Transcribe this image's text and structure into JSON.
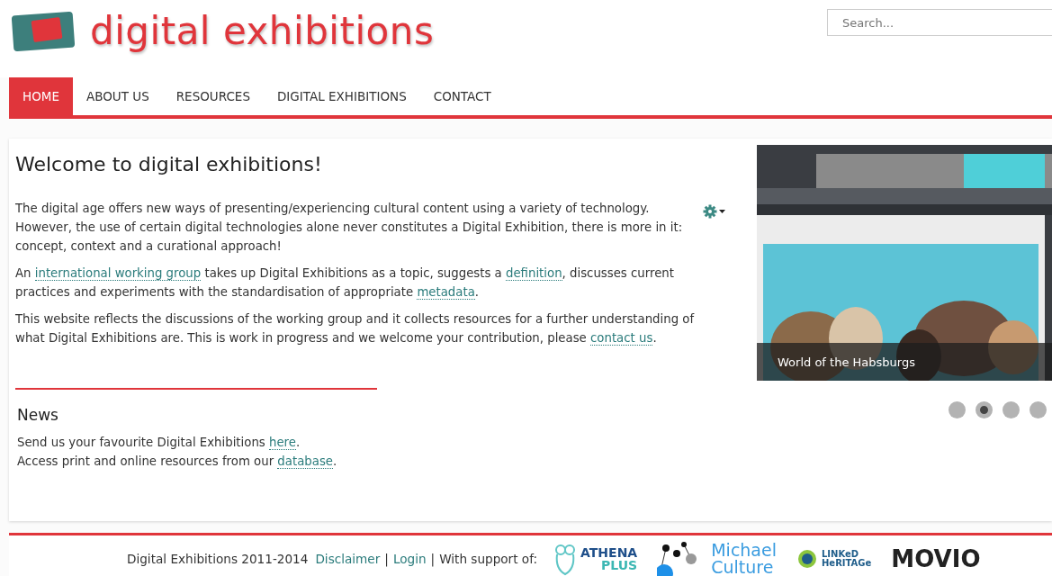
{
  "logo": {
    "text": "digital exhibitions"
  },
  "search": {
    "placeholder": "Search..."
  },
  "nav": [
    {
      "label": "HOME",
      "selected": true
    },
    {
      "label": "ABOUT US",
      "selected": false
    },
    {
      "label": "RESOURCES",
      "selected": false
    },
    {
      "label": "DIGITAL EXHIBITIONS",
      "selected": false
    },
    {
      "label": "CONTACT",
      "selected": false
    }
  ],
  "article": {
    "title": "Welcome to digital exhibitions!",
    "paragraphs": [
      [
        {
          "kind": "text",
          "text": "The digital age offers new ways of presenting/experiencing cultural content using a variety of technology. However, the use of certain digital technologies alone never constitutes a Digital Exhibition, there is more in it: concept, context and a curational approach!"
        }
      ],
      [
        {
          "kind": "text",
          "text": "An "
        },
        {
          "kind": "link",
          "text": "international working group"
        },
        {
          "kind": "text",
          "text": " takes up Digital Exhibitions as a topic, suggests a "
        },
        {
          "kind": "link",
          "text": "definition"
        },
        {
          "kind": "text",
          "text": ", discusses current practices and experiments with the standardisation of appropriate "
        },
        {
          "kind": "link",
          "text": "metadata"
        },
        {
          "kind": "text",
          "text": "."
        }
      ],
      [
        {
          "kind": "text",
          "text": "This website reflects the discussions of the working group and it collects resources for a further understanding of what Digital Exhibitions are. This is work in progress and we welcome your contribution, please "
        },
        {
          "kind": "link",
          "text": "contact us"
        },
        {
          "kind": "text",
          "text": "."
        }
      ]
    ]
  },
  "news": {
    "title": "News",
    "lines": [
      [
        {
          "kind": "text",
          "text": "Send us your favourite Digital Exhibitions "
        },
        {
          "kind": "link",
          "text": "here"
        },
        {
          "kind": "text",
          "text": "."
        }
      ],
      [
        {
          "kind": "text",
          "text": "Access print and online resources from our "
        },
        {
          "kind": "link",
          "text": "database"
        },
        {
          "kind": "text",
          "text": "."
        }
      ]
    ]
  },
  "slider": {
    "caption": "World of the Habsburgs",
    "dots": [
      {
        "selected": false
      },
      {
        "selected": true
      },
      {
        "selected": false
      },
      {
        "selected": false
      }
    ]
  },
  "footer": {
    "copyright": "Digital Exhibitions 2011-2014",
    "links": [
      "Disclaimer",
      "Login"
    ],
    "separators": [
      "|",
      "|"
    ],
    "support_label": "With support of:",
    "partners": [
      {
        "kind": "athena",
        "lines": [
          "ATHENA",
          "PLUS"
        ]
      },
      {
        "kind": "michael",
        "lines": [
          "Michael",
          "Culture"
        ]
      },
      {
        "kind": "linked",
        "lines": [
          "LINKeD",
          "HeRITAGe"
        ]
      },
      {
        "kind": "movio",
        "lines": [
          "MOVIO"
        ]
      }
    ]
  }
}
